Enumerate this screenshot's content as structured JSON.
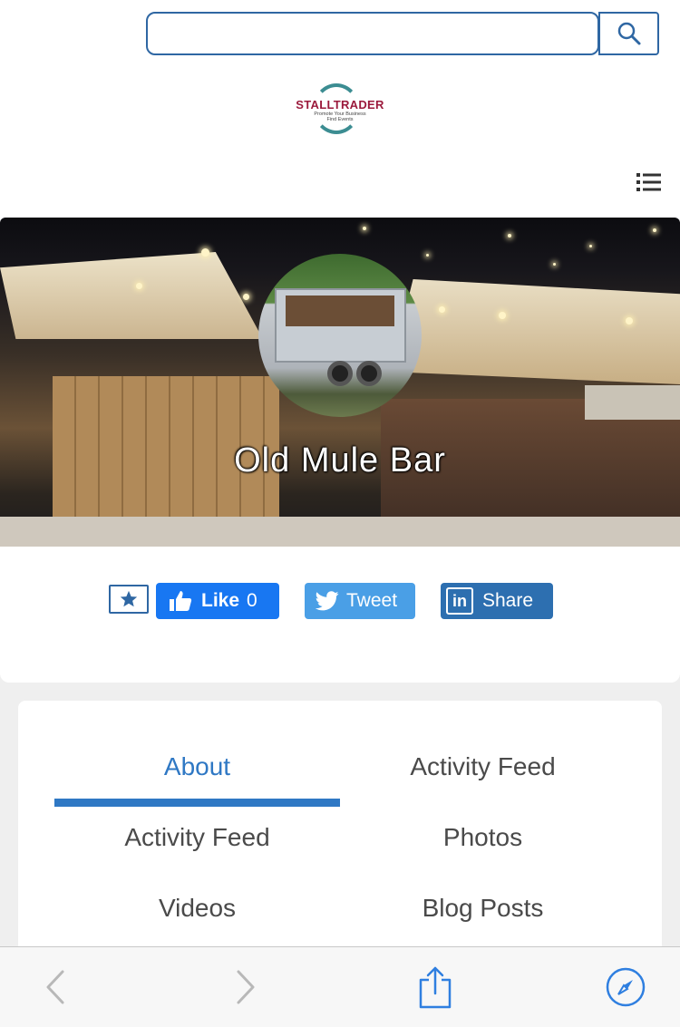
{
  "search": {
    "value": "",
    "placeholder": ""
  },
  "logo": {
    "name": "STALLTRADER",
    "tagline_1": "Promote Your Business",
    "tagline_2": "Find Events"
  },
  "profile": {
    "name": "Old Mule Bar"
  },
  "social": {
    "facebook": {
      "label": "Like",
      "count": "0"
    },
    "twitter": {
      "label": "Tweet"
    },
    "linkedin": {
      "icon_text": "in",
      "label": "Share"
    }
  },
  "tabs": [
    {
      "label": "About",
      "active": true
    },
    {
      "label": "Activity Feed",
      "active": false
    },
    {
      "label": "Activity Feed",
      "active": false
    },
    {
      "label": "Photos",
      "active": false
    },
    {
      "label": "Videos",
      "active": false
    },
    {
      "label": "Blog Posts",
      "active": false
    }
  ],
  "colors": {
    "accent": "#2f78c4",
    "brand": "#9b1a3c",
    "facebook": "#1877f2",
    "twitter": "#4a9fe6",
    "linkedin": "#2d6fb0"
  },
  "icons": [
    "search-icon",
    "list-menu-icon",
    "star-icon",
    "thumbs-up-icon",
    "twitter-bird-icon",
    "back-chevron-icon",
    "forward-chevron-icon",
    "share-icon",
    "compass-icon"
  ]
}
